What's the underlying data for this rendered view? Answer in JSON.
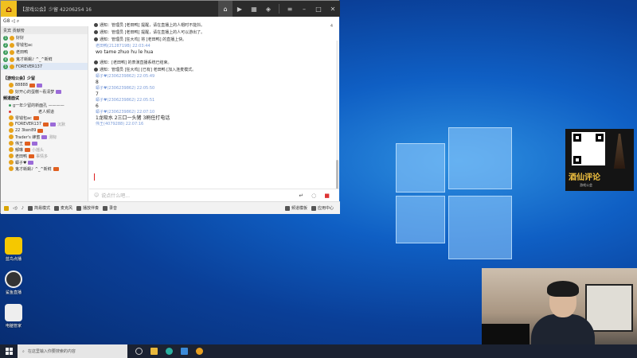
{
  "titlebar": {
    "text": "【游戏公会】少留  42206254  16",
    "icons": [
      "video-icon",
      "cards-icon",
      "gamepad-icon",
      "menu-icon",
      "minimize-icon",
      "maximize-icon",
      "close-icon"
    ]
  },
  "subbar": {
    "text": "G8 ◁ ⌕"
  },
  "left_pane": {
    "header": "贵宾  贡献榜",
    "ranks": [
      {
        "rank": "1",
        "name": "好好"
      },
      {
        "rank": "2",
        "name": "零钱包ac"
      },
      {
        "rank": "3",
        "name": "老田鸭"
      },
      {
        "rank": "4",
        "name": "鬼才蜥蜴♪ ^_^新鲜"
      },
      {
        "rank": "5",
        "name": "FOREVER137"
      }
    ],
    "section1": "【游戏公会】少留",
    "section1_users": [
      {
        "name": "88888"
      },
      {
        "name": "好开心的蛋糕~看清梦"
      }
    ],
    "section2": "频道面试",
    "section2_users": [
      {
        "name": "g一年少留的新面孔 ————"
      },
      {
        "name": "老人频道"
      }
    ],
    "members": [
      {
        "name": "零钱包ac",
        "extra": ""
      },
      {
        "name": "FOREVER137",
        "extra": "沉默"
      },
      {
        "name": "22 3ken89",
        "extra": ""
      },
      {
        "name": "Trader's 蜂蜜",
        "extra": "测标"
      },
      {
        "name": "伟王",
        "extra": ""
      },
      {
        "name": "郁琳",
        "extra": "小摇头"
      },
      {
        "name": "老田鸭",
        "extra": "事情多"
      },
      {
        "name": "蟒子♥",
        "extra": ""
      },
      {
        "name": "鬼才蜥蜴♪ ^_^新鲜",
        "extra": ""
      }
    ]
  },
  "chat": {
    "count": "4",
    "messages": [
      {
        "type": "system",
        "text": "通知：管理员 [老田鸭] 提醒，请在直播上的人帽时不能抖。"
      },
      {
        "type": "system",
        "text": "通知：管理员 [老田鸭] 提醒，请在直播上的人可以游出了。"
      },
      {
        "type": "system",
        "text": "通知：管理员 [狂大鸡] 将 [老田鸭] 的直播上快。"
      },
      {
        "type": "user",
        "meta": "老田鸭(2128719B)  22:03:44",
        "body": "wo tame zhuo hu le hua"
      },
      {
        "type": "system",
        "text": "通知：[老田鸭] 的表演直播系统已结束。"
      },
      {
        "type": "system",
        "text": "通知：管理员 [狂大鸡] [已有] 老田鸭 [加入连麦模式。"
      },
      {
        "type": "user",
        "meta": "蟒子♥(2306239862)  22:05:49",
        "body": "8"
      },
      {
        "type": "user",
        "meta": "蟒子♥(2306239862)  22:05:50",
        "body": "7"
      },
      {
        "type": "user",
        "meta": "蟒子♥(2306239862)  22:05:51",
        "body": "6"
      },
      {
        "type": "user",
        "meta": "蟒子♥(2306239862)  22:07:10",
        "body": "1龙吸水  2三口一头猪    3刷任打电话"
      },
      {
        "type": "user",
        "meta": "伟王(4079288)  22:07:16",
        "body": ""
      }
    ]
  },
  "input": {
    "placeholder": "说点什么吧..."
  },
  "bottombar": {
    "items": [
      "简易模式",
      "麦克风",
      "播放伴奏",
      "录音"
    ],
    "right": [
      "频道模板",
      "应用中心"
    ]
  },
  "desktop": {
    "icons": [
      "蓝鸟点播",
      "鲨鱼直播",
      "电脑管家"
    ]
  },
  "qr": {
    "title": "酒仙评论",
    "sub": "游戏公会"
  },
  "taskbar": {
    "search_placeholder": "在这里输入你要搜索的内容"
  }
}
